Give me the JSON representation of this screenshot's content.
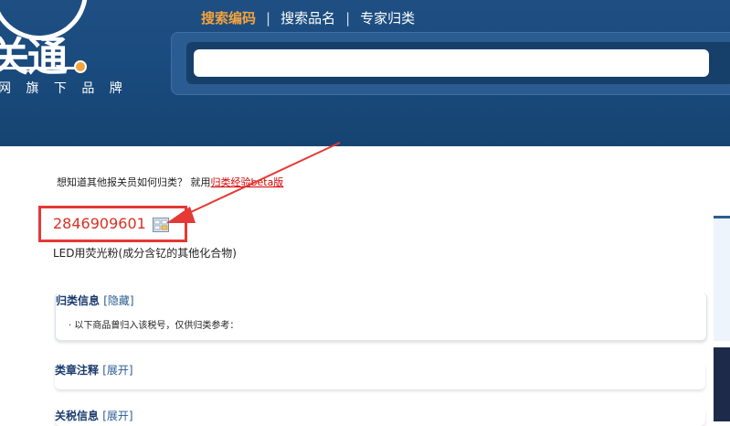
{
  "header": {
    "logo_text": "关通",
    "logo_subtitle": "网 旗 下 品 牌",
    "nav": [
      "搜索编码",
      "搜索品名",
      "专家归类"
    ],
    "separator": "|",
    "search": {
      "value": "",
      "placeholder": ""
    }
  },
  "hint": {
    "text": "想知道其他报关员如何归类？ 就用",
    "link": "归类经验beta版"
  },
  "product": {
    "code": "2846909601",
    "description": "LED用荧光粉(成分含钇的其他化合物)"
  },
  "sections": [
    {
      "title": "归类信息",
      "toggle": "[隐藏]",
      "row": "· 以下商品曾归入该税号，仅供归类参考："
    },
    {
      "title": "类章注释",
      "toggle": "[展开]"
    },
    {
      "title": "关税信息",
      "toggle": "[展开]"
    }
  ],
  "colors": {
    "header_bg": "#1a4b7e",
    "accent": "#f5a33c",
    "code_red": "#d93025",
    "highlight_red": "#e53935"
  }
}
